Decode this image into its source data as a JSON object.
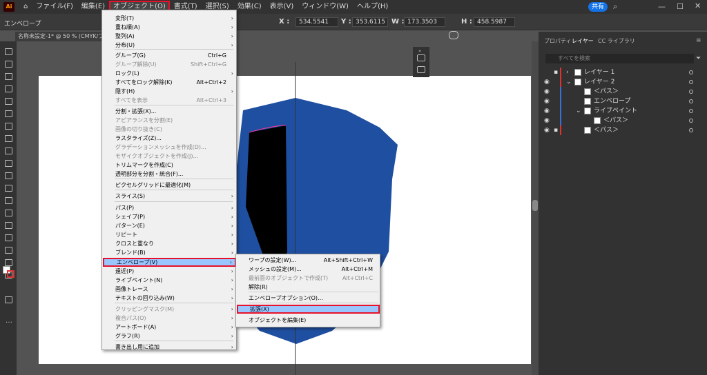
{
  "menubar": {
    "logo": "Ai",
    "items": [
      "ファイル(F)",
      "編集(E)",
      "オブジェクト(O)",
      "書式(T)",
      "選択(S)",
      "効果(C)",
      "表示(V)",
      "ウィンドウ(W)",
      "ヘルプ(H)"
    ],
    "share": "共有"
  },
  "controlbar": {
    "mode": "エンベロープ",
    "x_label": "X :",
    "x": "534.5541",
    "y_label": "Y :",
    "y": "353.6115",
    "w_label": "W :",
    "w": "173.3503",
    "h_label": "H :",
    "h": "458.5987"
  },
  "document": {
    "tab": "名称未設定-1* @ 50 % (CMYK/プレビュー)"
  },
  "object_menu": {
    "items": [
      {
        "label": "変形(T)",
        "shortcut": "",
        "arrow": "›",
        "disabled": false
      },
      {
        "label": "重ね順(A)",
        "shortcut": "",
        "arrow": "›",
        "disabled": false
      },
      {
        "label": "整列(A)",
        "shortcut": "",
        "arrow": "›",
        "disabled": false
      },
      {
        "label": "分布(U)",
        "shortcut": "",
        "arrow": "›",
        "disabled": false
      },
      {
        "label": "グループ(G)",
        "shortcut": "Ctrl+G",
        "arrow": "",
        "disabled": false
      },
      {
        "label": "グループ解除(U)",
        "shortcut": "Shift+Ctrl+G",
        "arrow": "",
        "disabled": true
      },
      {
        "label": "ロック(L)",
        "shortcut": "",
        "arrow": "›",
        "disabled": false
      },
      {
        "label": "すべてをロック解除(K)",
        "shortcut": "Alt+Ctrl+2",
        "arrow": "",
        "disabled": false
      },
      {
        "label": "隠す(H)",
        "shortcut": "",
        "arrow": "›",
        "disabled": false
      },
      {
        "label": "すべてを表示",
        "shortcut": "Alt+Ctrl+3",
        "arrow": "",
        "disabled": true
      },
      {
        "label": "分割・拡張(X)...",
        "shortcut": "",
        "arrow": "",
        "disabled": false
      },
      {
        "label": "アピアランスを分割(E)",
        "shortcut": "",
        "arrow": "",
        "disabled": true
      },
      {
        "label": "画像の切り抜き(C)",
        "shortcut": "",
        "arrow": "",
        "disabled": true
      },
      {
        "label": "ラスタライズ(Z)...",
        "shortcut": "",
        "arrow": "",
        "disabled": false
      },
      {
        "label": "グラデーションメッシュを作成(D)...",
        "shortcut": "",
        "arrow": "",
        "disabled": true
      },
      {
        "label": "モザイクオブジェクトを作成(J)...",
        "shortcut": "",
        "arrow": "",
        "disabled": true
      },
      {
        "label": "トリムマークを作成(C)",
        "shortcut": "",
        "arrow": "",
        "disabled": false
      },
      {
        "label": "透明部分を分割・統合(F)...",
        "shortcut": "",
        "arrow": "",
        "disabled": false
      },
      {
        "label": "ピクセルグリッドに最適化(M)",
        "shortcut": "",
        "arrow": "",
        "disabled": false
      },
      {
        "label": "スライス(S)",
        "shortcut": "",
        "arrow": "›",
        "disabled": false
      },
      {
        "label": "パス(P)",
        "shortcut": "",
        "arrow": "›",
        "disabled": false
      },
      {
        "label": "シェイプ(P)",
        "shortcut": "",
        "arrow": "›",
        "disabled": false
      },
      {
        "label": "パターン(E)",
        "shortcut": "",
        "arrow": "›",
        "disabled": false
      },
      {
        "label": "リピート",
        "shortcut": "",
        "arrow": "›",
        "disabled": false
      },
      {
        "label": "クロスと重なり",
        "shortcut": "",
        "arrow": "›",
        "disabled": false
      },
      {
        "label": "ブレンド(B)",
        "shortcut": "",
        "arrow": "›",
        "disabled": false
      },
      {
        "label": "エンベロープ(V)",
        "shortcut": "",
        "arrow": "›",
        "disabled": false,
        "highlighted": true
      },
      {
        "label": "遠近(P)",
        "shortcut": "",
        "arrow": "›",
        "disabled": false
      },
      {
        "label": "ライブペイント(N)",
        "shortcut": "",
        "arrow": "›",
        "disabled": false
      },
      {
        "label": "画像トレース",
        "shortcut": "",
        "arrow": "›",
        "disabled": false
      },
      {
        "label": "テキストの回り込み(W)",
        "shortcut": "",
        "arrow": "›",
        "disabled": false
      },
      {
        "label": "クリッピングマスク(M)",
        "shortcut": "",
        "arrow": "›",
        "disabled": true
      },
      {
        "label": "複合パス(O)",
        "shortcut": "",
        "arrow": "›",
        "disabled": true
      },
      {
        "label": "アートボード(A)",
        "shortcut": "",
        "arrow": "›",
        "disabled": false
      },
      {
        "label": "グラフ(R)",
        "shortcut": "",
        "arrow": "›",
        "disabled": false
      },
      {
        "label": "書き出し用に追加",
        "shortcut": "",
        "arrow": "›",
        "disabled": false
      }
    ]
  },
  "envelope_submenu": {
    "items": [
      {
        "label": "ワープの設定(W)...",
        "shortcut": "Alt+Shift+Ctrl+W",
        "disabled": false
      },
      {
        "label": "メッシュの設定(M)...",
        "shortcut": "Alt+Ctrl+M",
        "disabled": false
      },
      {
        "label": "最前面のオブジェクトで作成(T)",
        "shortcut": "Alt+Ctrl+C",
        "disabled": true
      },
      {
        "label": "解除(R)",
        "shortcut": "",
        "disabled": false
      },
      {
        "label": "エンベロープオプション(O)...",
        "shortcut": "",
        "disabled": false
      },
      {
        "label": "拡張(X)",
        "shortcut": "",
        "disabled": false,
        "highlighted": true
      },
      {
        "label": "オブジェクトを編集(E)",
        "shortcut": "",
        "disabled": false
      }
    ]
  },
  "right_panel": {
    "tabs": [
      "プロパティ",
      "レイヤー",
      "CC ライブラリ"
    ],
    "search_placeholder": "すべてを検索",
    "layers": [
      {
        "name": "レイヤー 1",
        "indent": 0
      },
      {
        "name": "レイヤー 2",
        "indent": 0
      },
      {
        "name": "＜パス＞",
        "indent": 1
      },
      {
        "name": "エンベロープ",
        "indent": 1
      },
      {
        "name": "ライブペイント",
        "indent": 1
      },
      {
        "name": "＜パス＞",
        "indent": 2
      },
      {
        "name": "＜パス＞",
        "indent": 1
      }
    ]
  },
  "colors": {
    "shield": "#1f4fa0",
    "highlight_border": "#e8102a",
    "menu_highlight": "#99c6ff",
    "layer_bar_red": "#e03030",
    "layer_bar_blue": "#3a6fd8"
  }
}
